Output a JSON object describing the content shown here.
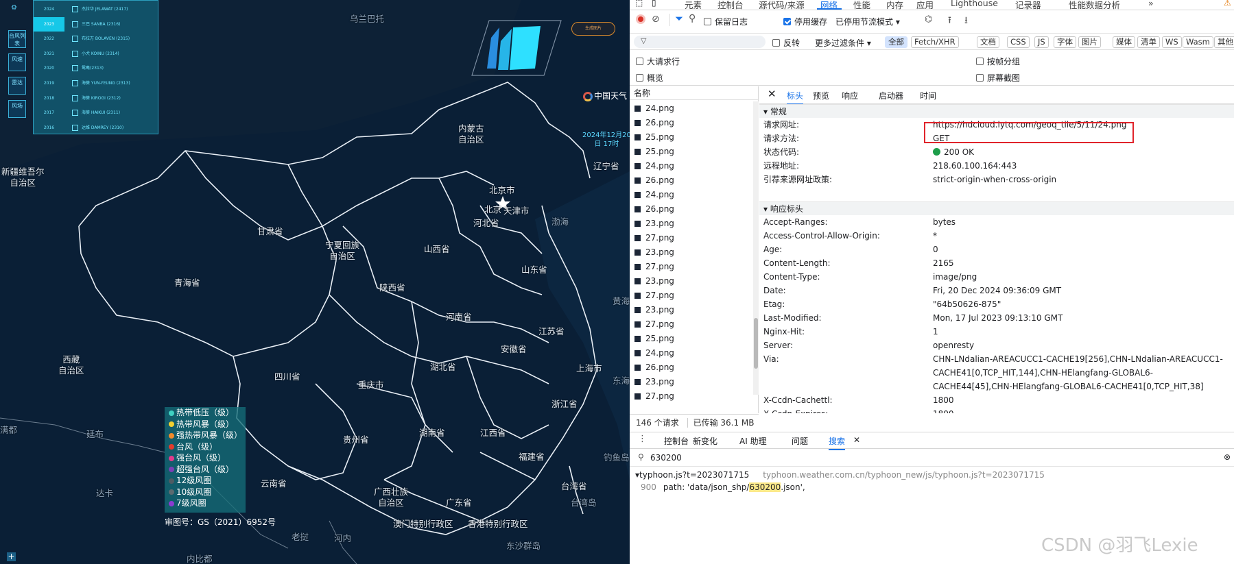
{
  "map": {
    "provinces": [
      {
        "name": "乌兰巴托",
        "id": "ulaanbaatar"
      },
      {
        "name": "内蒙古\n自治区",
        "id": "neimenggu"
      },
      {
        "name": "新疆维吾尔\n自治区",
        "id": "xinjiang"
      },
      {
        "name": "辽宁省",
        "id": "liaoning"
      },
      {
        "name": "北京市",
        "id": "beijing"
      },
      {
        "name": "北京",
        "id": "beijing-city"
      },
      {
        "name": "天津市",
        "id": "tianjin"
      },
      {
        "name": "河北省",
        "id": "hebei"
      },
      {
        "name": "甘肃省",
        "id": "gansu"
      },
      {
        "name": "宁夏回族\n自治区",
        "id": "ningxia"
      },
      {
        "name": "山西省",
        "id": "shanxi"
      },
      {
        "name": "山东省",
        "id": "shandong"
      },
      {
        "name": "渤海",
        "id": "bohai"
      },
      {
        "name": "青海省",
        "id": "qinghai"
      },
      {
        "name": "陕西省",
        "id": "shaanxi"
      },
      {
        "name": "河南省",
        "id": "henan"
      },
      {
        "name": "江苏省",
        "id": "jiangsu"
      },
      {
        "name": "黄海",
        "id": "huanghai"
      },
      {
        "name": "安徽省",
        "id": "anhui"
      },
      {
        "name": "西藏\n自治区",
        "id": "xizang"
      },
      {
        "name": "四川省",
        "id": "sichuan"
      },
      {
        "name": "湖北省",
        "id": "hubei"
      },
      {
        "name": "上海市",
        "id": "shanghai"
      },
      {
        "name": "重庆市",
        "id": "chongqing"
      },
      {
        "name": "浙江省",
        "id": "zhejiang"
      },
      {
        "name": "贵州省",
        "id": "guizhou"
      },
      {
        "name": "湖南省",
        "id": "hunan"
      },
      {
        "name": "江西省",
        "id": "jiangxi"
      },
      {
        "name": "东海",
        "id": "donghai"
      },
      {
        "name": "福建省",
        "id": "fujian"
      },
      {
        "name": "钓鱼岛",
        "id": "diaoyudao"
      },
      {
        "name": "云南省",
        "id": "yunnan"
      },
      {
        "name": "广西壮族\n自治区",
        "id": "guangxi"
      },
      {
        "name": "广东省",
        "id": "guangdong"
      },
      {
        "name": "台湾省",
        "id": "taiwan"
      },
      {
        "name": "台湾岛",
        "id": "taiwan-island"
      },
      {
        "name": "澳门特别行政区",
        "id": "macau"
      },
      {
        "name": "香港特别行政区",
        "id": "hongkong"
      },
      {
        "name": "东沙群岛",
        "id": "dongsha"
      },
      {
        "name": "老挝",
        "id": "laos"
      },
      {
        "name": "河内",
        "id": "hanoi"
      },
      {
        "name": "内比都",
        "id": "naypyidaw"
      },
      {
        "name": "达卡",
        "id": "dhaka"
      },
      {
        "name": "廷布",
        "id": "thimphu"
      },
      {
        "name": "满都",
        "id": "kathmandu"
      }
    ],
    "years": [
      {
        "year": "2024",
        "name": "杰拉华 JELAWAT (2417)"
      },
      {
        "year": "2023",
        "name": "三巴 SANBA (2316)"
      },
      {
        "year": "2022",
        "name": "布拉万 BOLAVEN (2315)"
      },
      {
        "year": "2021",
        "name": "小犬 KOINU (2314)"
      },
      {
        "year": "2020",
        "name": "鸳鸯(2313)"
      },
      {
        "year": "2019",
        "name": "海葵 YUN-YEUNG (2313)"
      },
      {
        "year": "2018",
        "name": "海葵 KIROGI (2312)"
      },
      {
        "year": "2017",
        "name": "海葵 HAIKUI (2311)"
      },
      {
        "year": "2016",
        "name": "达维 DAMREY (2310)"
      }
    ],
    "tools": [
      "台风列表",
      "风速",
      "雷达",
      "风场",
      "测距"
    ],
    "legend": [
      {
        "label": "热带低压（级）",
        "color": "#3fd1c2"
      },
      {
        "label": "热带风暴（级）",
        "color": "#f2d02f"
      },
      {
        "label": "强热带风暴（级）",
        "color": "#f08a2b"
      },
      {
        "label": "台风（级）",
        "color": "#e53b2c"
      },
      {
        "label": "强台风（级）",
        "color": "#e23a8c"
      },
      {
        "label": "超强台风（级）",
        "color": "#7b3fb5"
      },
      {
        "label": "12级风圈",
        "color": "#4f5b63"
      },
      {
        "label": "10级风圈",
        "color": "#5d6b70"
      },
      {
        "label": "7级风圈",
        "color": "#8c3bd1"
      }
    ],
    "approval_number": "审图号：GS（2021）6952号",
    "generate_button": "生成图片",
    "brand": "中国天气",
    "datetime": "2024年12月20\n日 17时"
  },
  "devtools": {
    "tabs": [
      "元素",
      "控制台",
      "源代码/来源",
      "网络",
      "性能",
      "内存",
      "应用",
      "Lighthouse",
      "记录器",
      "性能数据分析",
      "»"
    ],
    "active_tab": "网络",
    "preserve_log": "保留日志",
    "disable_cache": "停用缓存",
    "throttle": "已停用节流模式",
    "filter_placeholder": "过滤",
    "invert": "反转",
    "more_filters": "更多过滤条件",
    "type_filters": [
      "全部",
      "Fetch/XHR",
      "文档",
      "CSS",
      "JS",
      "字体",
      "图片",
      "媒体",
      "清单",
      "WS",
      "Wasm",
      "其他"
    ],
    "options": [
      "大请求行",
      "按帧分组",
      "概览",
      "屏幕截图"
    ],
    "list_header": "名称",
    "requests": [
      "24.png",
      "26.png",
      "25.png",
      "25.png",
      "24.png",
      "26.png",
      "24.png",
      "26.png",
      "23.png",
      "27.png",
      "23.png",
      "27.png",
      "23.png",
      "27.png",
      "23.png",
      "27.png",
      "25.png",
      "24.png",
      "26.png",
      "23.png",
      "27.png"
    ],
    "status_requests": "146 个请求",
    "status_transferred": "已传输 36.1 MB",
    "detail_tabs": [
      "标头",
      "预览",
      "响应",
      "启动器",
      "时间"
    ],
    "general_title": "常规",
    "general": [
      {
        "k": "请求网址:",
        "v": "https://hdcloud.lytq.com/geoq_tile/5/11/24.png"
      },
      {
        "k": "请求方法:",
        "v": "GET"
      },
      {
        "k": "状态代码:",
        "v": "200 OK"
      },
      {
        "k": "远程地址:",
        "v": "218.60.100.164:443"
      },
      {
        "k": "引荐来源网址政策:",
        "v": "strict-origin-when-cross-origin"
      }
    ],
    "response_title": "响应标头",
    "response": [
      {
        "k": "Accept-Ranges:",
        "v": "bytes"
      },
      {
        "k": "Access-Control-Allow-Origin:",
        "v": "*"
      },
      {
        "k": "Age:",
        "v": "0"
      },
      {
        "k": "Content-Length:",
        "v": "2165"
      },
      {
        "k": "Content-Type:",
        "v": "image/png"
      },
      {
        "k": "Date:",
        "v": "Fri, 20 Dec 2024 09:36:09 GMT"
      },
      {
        "k": "Etag:",
        "v": "\"64b50626-875\""
      },
      {
        "k": "Last-Modified:",
        "v": "Mon, 17 Jul 2023 09:13:10 GMT"
      },
      {
        "k": "Nginx-Hit:",
        "v": "1"
      },
      {
        "k": "Server:",
        "v": "openresty"
      },
      {
        "k": "Via:",
        "v": "CHN-LNdalian-AREACUCC1-CACHE19[256],CHN-LNdalian-AREACUCC1-CACHE41[0,TCP_HIT,144],CHN-HElangfang-GLOBAL6-CACHE44[45],CHN-HElangfang-GLOBAL6-CACHE41[0,TCP_HIT,38]"
      },
      {
        "k": "X-Ccdn-Cachettl:",
        "v": "1800"
      },
      {
        "k": "X-Ccdn-Expires:",
        "v": "1800"
      }
    ],
    "drawer_tabs": [
      "控制台",
      "新变化",
      "AI 助理",
      "问题",
      "搜索"
    ],
    "search_query": "630200",
    "result_file": "typhoon.js?t=2023071715",
    "result_url": "typhoon.weather.com.cn/typhoon_new/js/typhoon.js?t=2023071715",
    "result_line": "900",
    "result_text_before": "path: 'data/json_shp/",
    "result_match": "630200",
    "result_text_after": ".json',"
  },
  "watermark": "CSDN @羽飞Lexie",
  "colors": {
    "accent": "#1a73e8",
    "highlight_box": "#e0242b",
    "map_bg": "#0a1f36",
    "panel": "#125870"
  }
}
